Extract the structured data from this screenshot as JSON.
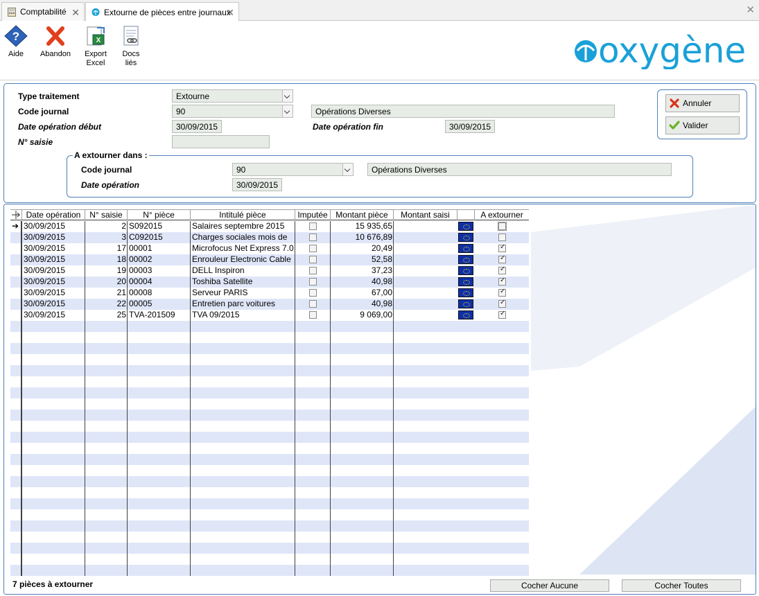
{
  "tabs": [
    {
      "label": "Comptabilité"
    },
    {
      "label": "Extourne de pièces entre journaux"
    }
  ],
  "toolbar": {
    "aide": "Aide",
    "abandon": "Abandon",
    "export_l1": "Export",
    "export_l2": "Excel",
    "docs_l1": "Docs",
    "docs_l2": "liés"
  },
  "logo": "oxygène",
  "form": {
    "type_traitement_label": "Type traitement",
    "type_traitement_value": "Extourne",
    "code_journal_label": "Code journal",
    "code_journal_value": "90",
    "code_journal_desc": "Opérations Diverses",
    "date_debut_label": "Date opération début",
    "date_debut_value": "30/09/2015",
    "date_fin_label": "Date opération fin",
    "date_fin_value": "30/09/2015",
    "num_saisie_label": "N° saisie",
    "num_saisie_value": ""
  },
  "group": {
    "title": "A extourner dans :",
    "code_journal_label": "Code journal",
    "code_journal_value": "90",
    "code_journal_desc": "Opérations Diverses",
    "date_label": "Date opération",
    "date_value": "30/09/2015"
  },
  "actions": {
    "annuler": "Annuler",
    "valider": "Valider"
  },
  "grid": {
    "headers": [
      "Date opération",
      "N° saisie",
      "N° pièce",
      "Intitulé pièce",
      "Imputée",
      "Montant pièce",
      "Montant saisi",
      "",
      "A extourner"
    ],
    "rows": [
      {
        "date": "30/09/2015",
        "saisie": "2",
        "piece": "S092015",
        "intitule": "Salaires septembre 2015",
        "imputee": false,
        "montant": "15 935,65",
        "extourner": false
      },
      {
        "date": "30/09/2015",
        "saisie": "3",
        "piece": "C092015",
        "intitule": "Charges sociales mois de",
        "imputee": false,
        "montant": "10 676,89",
        "extourner": false
      },
      {
        "date": "30/09/2015",
        "saisie": "17",
        "piece": "00001",
        "intitule": "Microfocus Net Express 7.0",
        "imputee": false,
        "montant": "20,49",
        "extourner": true
      },
      {
        "date": "30/09/2015",
        "saisie": "18",
        "piece": "00002",
        "intitule": "Enrouleur Electronic Cable",
        "imputee": false,
        "montant": "52,58",
        "extourner": true
      },
      {
        "date": "30/09/2015",
        "saisie": "19",
        "piece": "00003",
        "intitule": "DELL Inspiron",
        "imputee": false,
        "montant": "37,23",
        "extourner": true
      },
      {
        "date": "30/09/2015",
        "saisie": "20",
        "piece": "00004",
        "intitule": "Toshiba Satellite",
        "imputee": false,
        "montant": "40,98",
        "extourner": true
      },
      {
        "date": "30/09/2015",
        "saisie": "21",
        "piece": "00008",
        "intitule": "Serveur PARIS",
        "imputee": false,
        "montant": "67,00",
        "extourner": true
      },
      {
        "date": "30/09/2015",
        "saisie": "22",
        "piece": "00005",
        "intitule": "Entretien parc voitures",
        "imputee": false,
        "montant": "40,98",
        "extourner": true
      },
      {
        "date": "30/09/2015",
        "saisie": "25",
        "piece": "TVA-201509",
        "intitule": "TVA 09/2015",
        "imputee": false,
        "montant": "9 069,00",
        "extourner": true
      }
    ]
  },
  "footer": {
    "count_label": "7 pièces à extourner",
    "cocher_aucune": "Cocher Aucune",
    "cocher_toutes": "Cocher Toutes"
  },
  "colors": {
    "border_blue": "#4f7fb8",
    "row_alt": "#dfe6f8",
    "field_bg": "#e7ece7",
    "logo_blue": "#1aa0d8"
  }
}
